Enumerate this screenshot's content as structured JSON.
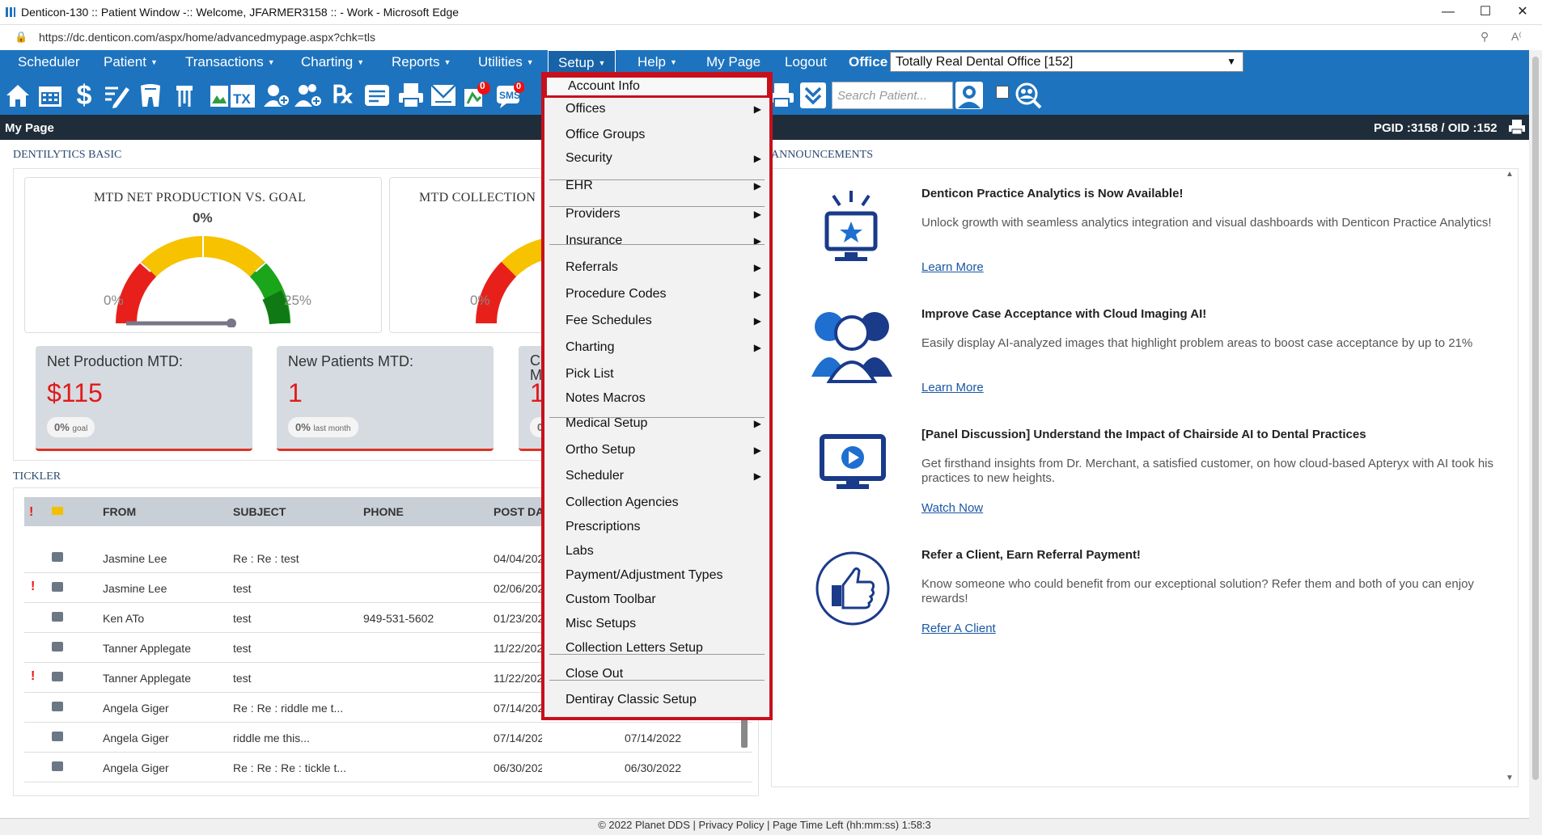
{
  "window": {
    "title": "Denticon-130 :: Patient Window -:: Welcome, JFARMER3158 :: - Work - Microsoft Edge",
    "url": "https://dc.denticon.com/aspx/home/advancedmypage.aspx?chk=tls"
  },
  "nav": {
    "items": [
      "Scheduler",
      "Patient",
      "Transactions",
      "Charting",
      "Reports",
      "Utilities",
      "Setup",
      "Help",
      "My Page",
      "Logout"
    ],
    "office_label": "Office",
    "office_value": "Totally Real Dental Office [152]"
  },
  "toolbar": {
    "search_placeholder": "Search Patient...",
    "icons": [
      "home-icon",
      "calendar-icon",
      "dollar-icon",
      "edit-icon",
      "tooth-icon",
      "implant-icon",
      "image-icon",
      "treatment-icon",
      "add-patient-icon",
      "add-family-icon",
      "rx-icon",
      "notes-icon",
      "print-icon",
      "mail-icon",
      "flag-icon",
      "sms-icon"
    ],
    "sms_badge": "0",
    "flag_badge": "0"
  },
  "header": {
    "title": "My Page",
    "pgid": "PGID :3158  /  OID :152"
  },
  "dentilytics": {
    "title": "DENTILYTICS BASIC",
    "gauges": [
      {
        "title": "MTD NET PRODUCTION VS. GOAL",
        "value": "0%",
        "min": "0%",
        "max": "25%"
      },
      {
        "title": "MTD COLLECTION",
        "min": "0%"
      }
    ],
    "kpis": [
      {
        "label": "Net Production MTD:",
        "value": "$115",
        "pill": "0%",
        "pill_sub": "goal"
      },
      {
        "label": "New Patients MTD:",
        "value": "1",
        "pill": "0%",
        "pill_sub": "last month"
      },
      {
        "label": "C M",
        "value": "1",
        "pill": "0"
      }
    ]
  },
  "tickler": {
    "title": "TICKLER",
    "columns": [
      "FROM",
      "SUBJECT",
      "PHONE",
      "POST DA"
    ],
    "rows": [
      {
        "flag": false,
        "from": "Jasmine Lee",
        "subject": "Re : Re : test",
        "phone": "",
        "post": "04/04/202",
        "due": ""
      },
      {
        "flag": true,
        "from": "Jasmine Lee",
        "subject": "test",
        "phone": "",
        "post": "02/06/202",
        "due": ""
      },
      {
        "flag": false,
        "from": "Ken ATo",
        "subject": "test",
        "phone": "949-531-5602",
        "post": "01/23/202",
        "due": ""
      },
      {
        "flag": false,
        "from": "Tanner Applegate",
        "subject": "test",
        "phone": "",
        "post": "11/22/202",
        "due": ""
      },
      {
        "flag": true,
        "from": "Tanner Applegate",
        "subject": "test",
        "phone": "",
        "post": "11/22/202",
        "due": ""
      },
      {
        "flag": false,
        "from": "Angela Giger",
        "subject": "Re : Re : riddle me t...",
        "phone": "",
        "post": "07/14/202",
        "due": ""
      },
      {
        "flag": false,
        "from": "Angela Giger",
        "subject": "riddle me this...",
        "phone": "",
        "post": "07/14/2022",
        "due": "07/14/2022"
      },
      {
        "flag": false,
        "from": "Angela Giger",
        "subject": "Re : Re : Re : tickle t...",
        "phone": "",
        "post": "06/30/2022",
        "due": "06/30/2022"
      }
    ]
  },
  "announcements": {
    "title": "ANNOUNCEMENTS",
    "items": [
      {
        "title": "Denticon Practice Analytics is Now Available!",
        "body": "Unlock growth with seamless analytics integration and visual dashboards with Denticon Practice Analytics!",
        "link": "Learn More"
      },
      {
        "title": "Improve Case Acceptance with Cloud Imaging AI!",
        "body": "Easily display AI-analyzed images that highlight problem areas to boost case acceptance by up to 21%",
        "link": "Learn More"
      },
      {
        "title": "[Panel Discussion] Understand the Impact of Chairside AI to Dental Practices",
        "body": "Get firsthand insights from Dr. Merchant, a satisfied customer, on how cloud-based Apteryx with AI took his practices to new heights.",
        "link": "Watch Now"
      },
      {
        "title": "Refer a Client, Earn Referral Payment!",
        "body": "Know someone who could benefit from our exceptional solution? Refer them and both of you can enjoy rewards!",
        "link": "Refer A Client"
      }
    ]
  },
  "setup_menu": {
    "items": [
      {
        "label": "Account Info",
        "sub": false
      },
      {
        "label": "Offices",
        "sub": true
      },
      {
        "label": "Office Groups",
        "sub": false
      },
      {
        "label": "Security",
        "sub": true
      },
      {
        "label": "EHR",
        "sub": true
      },
      {
        "label": "Providers",
        "sub": true
      },
      {
        "label": "Insurance",
        "sub": true
      },
      {
        "label": "Referrals",
        "sub": true
      },
      {
        "label": "Procedure Codes",
        "sub": true
      },
      {
        "label": "Fee Schedules",
        "sub": true
      },
      {
        "label": "Charting",
        "sub": true
      },
      {
        "label": "Pick List",
        "sub": false
      },
      {
        "label": "Notes Macros",
        "sub": false
      },
      {
        "label": "Medical Setup",
        "sub": true
      },
      {
        "label": "Ortho Setup",
        "sub": true
      },
      {
        "label": "Scheduler",
        "sub": true
      },
      {
        "label": "Collection Agencies",
        "sub": false
      },
      {
        "label": "Prescriptions",
        "sub": false
      },
      {
        "label": "Labs",
        "sub": false
      },
      {
        "label": "Payment/Adjustment Types",
        "sub": false
      },
      {
        "label": "Custom Toolbar",
        "sub": false
      },
      {
        "label": "Misc Setups",
        "sub": false
      },
      {
        "label": "Collection Letters Setup",
        "sub": false
      },
      {
        "label": "Close Out",
        "sub": false
      },
      {
        "label": "Dentiray Classic Setup",
        "sub": false
      }
    ]
  },
  "footer": {
    "text": "© 2022 Planet DDS | Privacy Policy | Page Time Left (hh:mm:ss) 1:58:3"
  },
  "colors": {
    "nav_blue": "#1e73be",
    "header_dark": "#1f2d3a",
    "menu_outline": "#c8101c",
    "kpi_red": "#e01b1b"
  }
}
